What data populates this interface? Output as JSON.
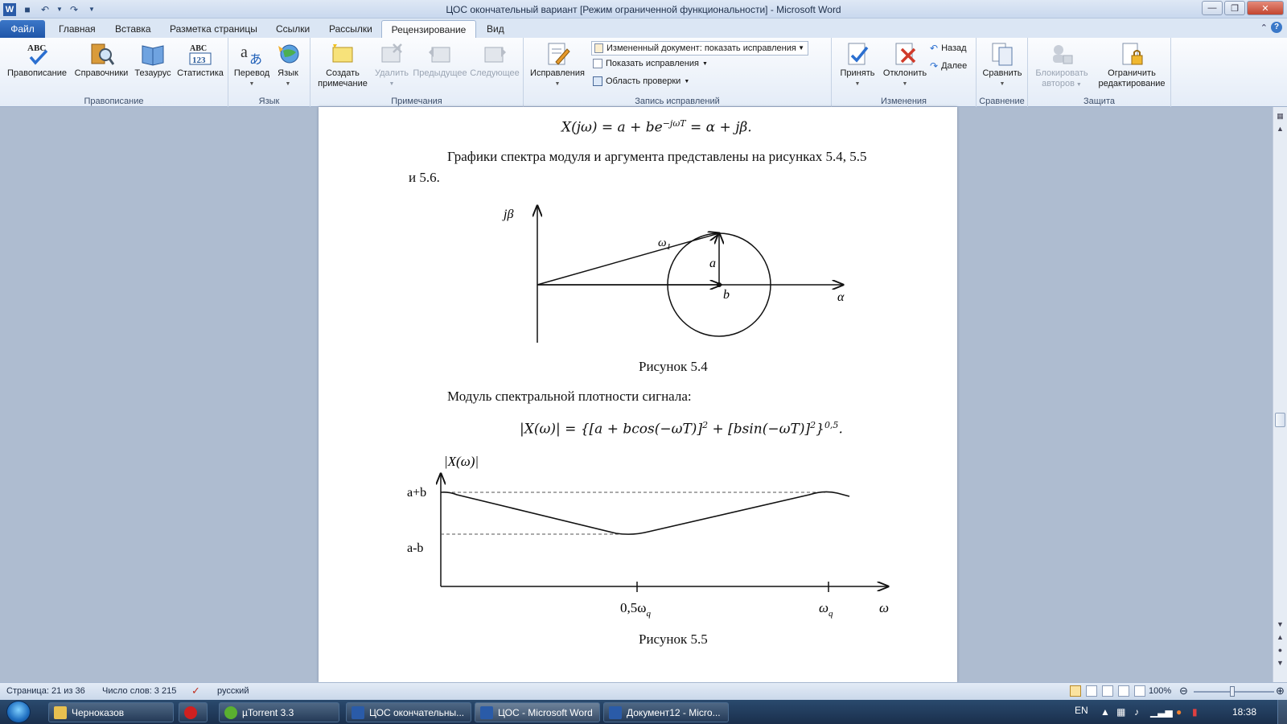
{
  "window": {
    "title": "ЦОС окончательный вариант [Режим ограниченной функциональности]  -  Microsoft Word",
    "app_icon": "W"
  },
  "tabs": [
    "Файл",
    "Главная",
    "Вставка",
    "Разметка страницы",
    "Ссылки",
    "Рассылки",
    "Рецензирование",
    "Вид"
  ],
  "active_tab": "Рецензирование",
  "ribbon": {
    "groups": {
      "spelling": "Правописание",
      "language": "Язык",
      "comments": "Примечания",
      "tracking": "Запись исправлений",
      "changes": "Изменения",
      "compare": "Сравнение",
      "protect": "Защита"
    },
    "buttons": {
      "spelling": "Правописание",
      "research": "Справочники",
      "thesaurus": "Тезаурус",
      "stats": "Статистика",
      "translate": "Перевод",
      "language": "Язык",
      "new_comment_1": "Создать",
      "new_comment_2": "примечание",
      "delete": "Удалить",
      "previous": "Предыдущее",
      "next": "Следующее",
      "track": "Исправления",
      "display_mode": "Измененный документ: показать исправления",
      "show_markup": "Показать исправления",
      "review_pane": "Область проверки",
      "accept": "Принять",
      "reject": "Отклонить",
      "prev_change": "Назад",
      "next_change": "Далее",
      "compare": "Сравнить",
      "block_1": "Блокировать",
      "block_2": "авторов",
      "restrict_1": "Ограничить",
      "restrict_2": "редактирование"
    },
    "icon_text": {
      "abc": "ABC",
      "abc123_top": "ABC",
      "abc123_bottom": "123"
    }
  },
  "document": {
    "eq1": "X(jω) = a + be",
    "eq1_sup": "−jωT",
    "eq1_tail": " = α + jβ.",
    "para1_line1": "Графики спектра модуля и аргумента представлены на рисунках 5.4, 5.5",
    "para1_line2": "и 5.6.",
    "fig1": {
      "label_y": "jβ",
      "label_x": "α",
      "label_omega": "ω",
      "label_omega_sub": "1",
      "label_a": "a",
      "label_b": "b"
    },
    "cap1": "Рисунок 5.4",
    "para2": "Модуль спектральной плотности сигнала:",
    "eq2": "|X(ω)| = {[a + bcos(−ωT)]",
    "eq2_s1": "2",
    "eq2_mid": " + [bsin(−ωT)]",
    "eq2_s2": "2",
    "eq2_close": "}",
    "eq2_s3": "0,5",
    "eq2_end": ".",
    "fig2": {
      "ylabel": "|X(ω)|",
      "ymax": "a+b",
      "ymin": "a-b",
      "x1": "0,5ω",
      "x1_sub": "q",
      "x2": "ω",
      "x2_sub": "q",
      "xaxis": "ω"
    },
    "cap2": "Рисунок 5.5"
  },
  "status": {
    "page": "Страница: 21 из 36",
    "words": "Число слов: 3 215",
    "lang": "русский",
    "zoom": "100%"
  },
  "taskbar": {
    "items": [
      "Черноказов",
      "µTorrent 3.3",
      "ЦОС окончательны...",
      "ЦОС - Microsoft Word",
      "Документ12 - Micro..."
    ],
    "lang": "EN",
    "clock": "18:38"
  },
  "colors": {
    "file_tab": "#2a63b5",
    "ribbon_bg": "#eef3fa",
    "workspace": "#aebcd0"
  }
}
